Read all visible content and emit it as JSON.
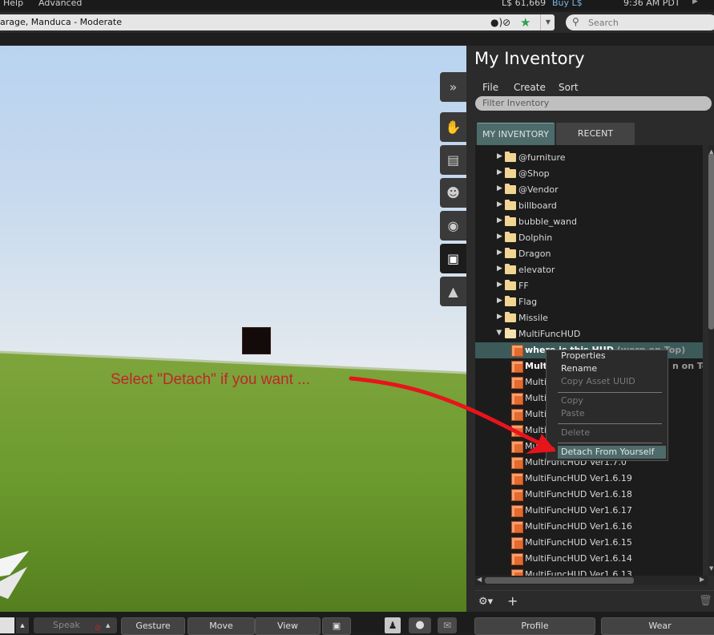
{
  "menubar": {
    "items": [
      "Help",
      "Advanced"
    ],
    "balance": "L$ 61,669",
    "buy": "Buy L$",
    "time": "9:36 AM PDT"
  },
  "location": {
    "text": "arage, Manduca - Moderate",
    "search_placeholder": "Search"
  },
  "world": {
    "annotation": "Select \"Detach\" if you want ..."
  },
  "inventory": {
    "title": "My Inventory",
    "menu": [
      "File",
      "Create",
      "Sort"
    ],
    "filter_placeholder": "Filter Inventory",
    "tabs": [
      "MY INVENTORY",
      "RECENT"
    ],
    "folders": [
      "@furniture",
      "@Shop",
      "@Vendor",
      "billboard",
      "bubble_wand",
      "Dolphin",
      "Dragon",
      "elevator",
      "FF",
      "Flag",
      "Missile",
      "MultiFuncHUD"
    ],
    "items": [
      {
        "label": "where is this HUD",
        "worn": "(worn on Top)"
      },
      {
        "label": "Mult",
        "worn": "n on Top)"
      },
      {
        "label": "Multi",
        "worn": ""
      },
      {
        "label": "Multi",
        "worn": ""
      },
      {
        "label": "Multi",
        "worn": ""
      },
      {
        "label": "Multi",
        "worn": ""
      },
      {
        "label": "Mu",
        "worn": ""
      },
      {
        "label": "MultiFuncHUD Ver1.7.0",
        "worn": ""
      },
      {
        "label": "MultiFuncHUD Ver1.6.19",
        "worn": ""
      },
      {
        "label": "MultiFuncHUD Ver1.6.18",
        "worn": ""
      },
      {
        "label": "MultiFuncHUD Ver1.6.17",
        "worn": ""
      },
      {
        "label": "MultiFuncHUD Ver1.6.16",
        "worn": ""
      },
      {
        "label": "MultiFuncHUD Ver1.6.15",
        "worn": ""
      },
      {
        "label": "MultiFuncHUD Ver1.6.14",
        "worn": ""
      },
      {
        "label": "MultiFuncHUD Ver1.6.13",
        "worn": ""
      }
    ]
  },
  "context_menu": {
    "properties": "Properties",
    "rename": "Rename",
    "copy_uuid": "Copy Asset UUID",
    "copy": "Copy",
    "paste": "Paste",
    "delete": "Delete",
    "detach": "Detach From Yourself"
  },
  "toolbar": {
    "speak": "Speak",
    "gesture": "Gesture",
    "move": "Move",
    "view": "View",
    "profile": "Profile",
    "wear": "Wear"
  },
  "colors": {
    "selection": "#4e6b6b",
    "arrow": "#e8141c",
    "annotation": "#c0262a"
  }
}
